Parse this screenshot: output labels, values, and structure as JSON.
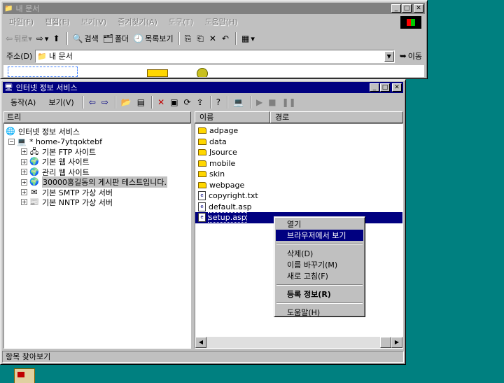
{
  "colors": {
    "desktop": "#008080",
    "active_title": "#000080",
    "inactive_title": "#808080",
    "selection": "#000080"
  },
  "explorer": {
    "title": "내 문서",
    "menus": [
      "파일(F)",
      "편집(E)",
      "보기(V)",
      "즐겨찾기(A)",
      "도구(T)",
      "도움말(H)"
    ],
    "toolbar": {
      "back": "뒤로",
      "search": "검색",
      "folders": "폴더",
      "history": "목록보기"
    },
    "address_label": "주소(D)",
    "address_value": "내 문서",
    "go_label": "이동"
  },
  "iis": {
    "title": "인터넷 정보 서비스",
    "menus": [
      "동작(A)",
      "보기(V)"
    ],
    "tree_header": "트리",
    "list_headers": {
      "name": "이름",
      "path": "경로"
    },
    "tree": {
      "root": "인터넷 정보 서비스",
      "server": "* home-7ytqoktebf",
      "sites": [
        "기본 FTP 사이트",
        "기본 웹 사이트",
        "관리 웹 사이트",
        "30000홍길동의 게시판 테스트입니다.",
        "기본 SMTP 가상 서버",
        "기본 NNTP 가상 서버"
      ]
    },
    "files": [
      {
        "name": "adpage",
        "kind": "folder"
      },
      {
        "name": "data",
        "kind": "folder"
      },
      {
        "name": "Jsource",
        "kind": "folder"
      },
      {
        "name": "mobile",
        "kind": "folder"
      },
      {
        "name": "skin",
        "kind": "folder"
      },
      {
        "name": "webpage",
        "kind": "folder"
      },
      {
        "name": "copyright.txt",
        "kind": "file"
      },
      {
        "name": "default.asp",
        "kind": "file"
      },
      {
        "name": "setup.asp",
        "kind": "file"
      }
    ],
    "status": "항목 찾아보기"
  },
  "context_menu": {
    "items": [
      "열기",
      "브라우저에서 보기",
      "삭제(D)",
      "이름 바꾸기(M)",
      "새로 고침(F)",
      "등록 정보(R)",
      "도움말(H)"
    ]
  }
}
